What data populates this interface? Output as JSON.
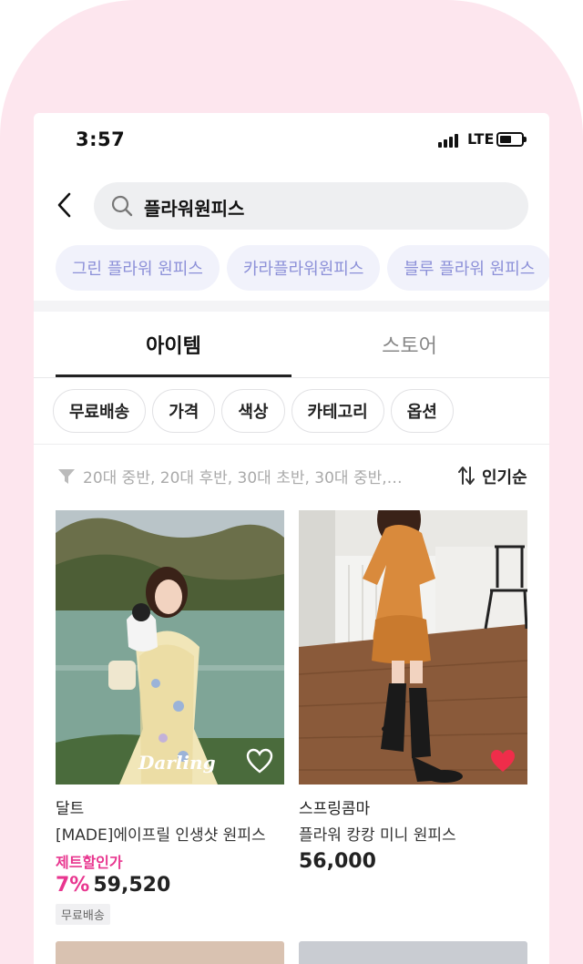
{
  "status_bar": {
    "time": "3:57",
    "network": "LTE"
  },
  "search": {
    "query": "플라워원피스"
  },
  "keyword_chips": [
    "그린 플라워 원피스",
    "카라플라워원피스",
    "블루 플라워 원피스"
  ],
  "tabs": [
    {
      "label": "아이템",
      "active": true
    },
    {
      "label": "스토어",
      "active": false
    }
  ],
  "filters": [
    "무료배송",
    "가격",
    "색상",
    "카테고리",
    "옵션"
  ],
  "tag_summary": "20대 중반, 20대 후반, 30대 초반, 30대 중반,…",
  "sort": {
    "label": "인기순"
  },
  "colors": {
    "accent_pink": "#e8368f",
    "chip_text": "#8c90d8",
    "heart_red": "#ef2d4a"
  },
  "products": [
    {
      "store": "달트",
      "name": "[MADE]에이프릴 인생샷 원피스",
      "sale_label": "제트할인가",
      "discount": "7%",
      "price": "59,520",
      "badge": "무료배송",
      "image_caption": "Darling",
      "liked": false
    },
    {
      "store": "스프링콤마",
      "name": "플라워 캉캉 미니 원피스",
      "price": "56,000",
      "liked": true
    }
  ]
}
